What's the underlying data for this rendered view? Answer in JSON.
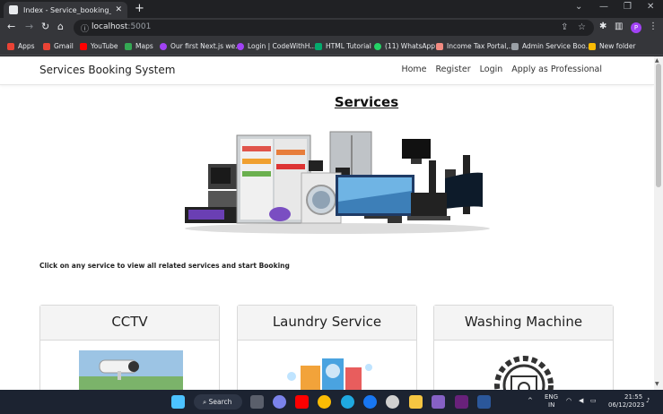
{
  "browser": {
    "tab_title": "Index - Service_booking_system",
    "url_host": "localhost",
    "url_port": ":5001",
    "profile_initial": "P"
  },
  "bookmarks": [
    {
      "label": "Apps",
      "color": "#ea4335"
    },
    {
      "label": "Gmail",
      "color": "#ea4335"
    },
    {
      "label": "YouTube",
      "color": "#ff0000"
    },
    {
      "label": "Maps",
      "color": "#34a853"
    },
    {
      "label": "Our first Next.js we...",
      "color": "#a142f4"
    },
    {
      "label": "Login | CodeWithH...",
      "color": "#a142f4"
    },
    {
      "label": "HTML Tutorial",
      "color": "#04aa6d"
    },
    {
      "label": "(11) WhatsApp",
      "color": "#25d366"
    },
    {
      "label": "Income Tax Portal,...",
      "color": "#f28b82"
    },
    {
      "label": "Admin Service Boo...",
      "color": "#9aa0a6"
    },
    {
      "label": "New folder",
      "color": "#fbbc04"
    }
  ],
  "page": {
    "brand": "Services Booking System",
    "nav": [
      "Home",
      "Register",
      "Login",
      "Apply as Professional"
    ],
    "heading": "Services",
    "hint": "Click on any service to view all related services and start Booking",
    "cards": [
      "CCTV",
      "Laundry Service",
      "Washing Machine"
    ]
  },
  "taskbar": {
    "search_label": "Search",
    "lang_1": "ENG",
    "lang_2": "IN",
    "time": "21:55",
    "date": "06/12/2023"
  }
}
